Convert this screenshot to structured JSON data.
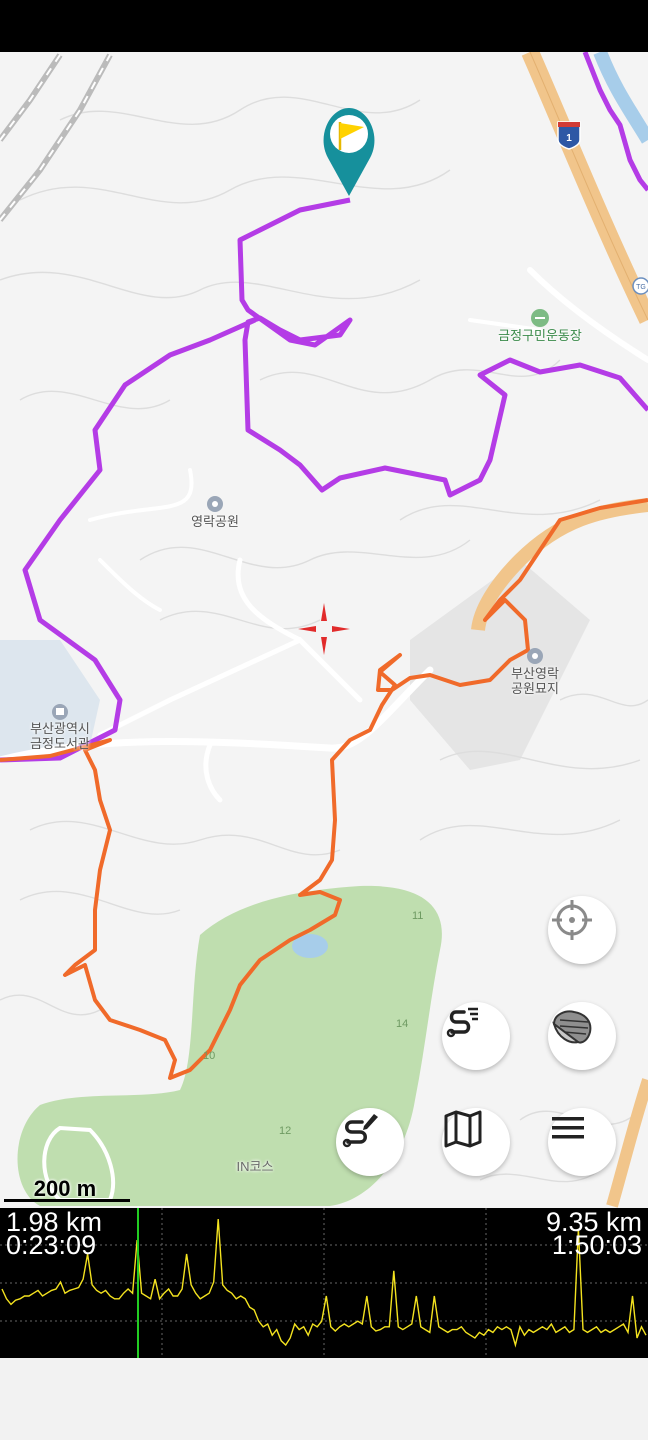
{
  "map": {
    "poi": {
      "sports_ground": "금정구민운동장",
      "park": "영락공원",
      "cemetery": "부산영락\n공원묘지",
      "library": "부산광역시\n금정도서관",
      "highway_shield": "1",
      "toll_gate": "TG",
      "golf_course": "IN코스",
      "holes": [
        "11",
        "14",
        "10",
        "12"
      ]
    },
    "scale_label": "200 m",
    "track_colors": {
      "purple": "#b43ce6",
      "orange": "#f06a2a",
      "highway": "#f1c58b"
    }
  },
  "buttons": {
    "locate": "crosshair-icon",
    "track_list": "track-list-icon",
    "map_style": "layers-icon",
    "draw_route": "route-draw-icon",
    "maps": "map-icon",
    "menu": "menu-icon"
  },
  "elevation": {
    "current_distance": "1.98 km",
    "current_time": "0:23:09",
    "total_distance": "9.35 km",
    "total_time": "1:50:03",
    "line_color": "#f3e21f",
    "cursor_color": "#22cc22",
    "profile_values": [
      0.55,
      0.62,
      0.66,
      0.63,
      0.62,
      0.6,
      0.6,
      0.58,
      0.56,
      0.6,
      0.58,
      0.56,
      0.55,
      0.5,
      0.58,
      0.56,
      0.55,
      0.54,
      0.48,
      0.3,
      0.52,
      0.56,
      0.58,
      0.56,
      0.6,
      0.62,
      0.62,
      0.58,
      0.55,
      0.58,
      0.2,
      0.58,
      0.6,
      0.62,
      0.48,
      0.62,
      0.58,
      0.55,
      0.6,
      0.6,
      0.55,
      0.3,
      0.52,
      0.58,
      0.62,
      0.6,
      0.58,
      0.5,
      0.05,
      0.52,
      0.56,
      0.58,
      0.62,
      0.6,
      0.62,
      0.68,
      0.7,
      0.78,
      0.82,
      0.8,
      0.88,
      0.84,
      0.92,
      0.95,
      0.9,
      0.8,
      0.84,
      0.82,
      0.88,
      0.8,
      0.82,
      0.78,
      0.6,
      0.82,
      0.85,
      0.82,
      0.8,
      0.82,
      0.8,
      0.78,
      0.8,
      0.6,
      0.82,
      0.85,
      0.84,
      0.82,
      0.82,
      0.42,
      0.82,
      0.84,
      0.82,
      0.8,
      0.6,
      0.82,
      0.84,
      0.86,
      0.6,
      0.82,
      0.84,
      0.86,
      0.84,
      0.84,
      0.82,
      0.86,
      0.88,
      0.9,
      0.86,
      0.88,
      0.84,
      0.86,
      0.82,
      0.84,
      0.82,
      0.84,
      0.95,
      0.82,
      0.88,
      0.84,
      0.86,
      0.84,
      0.82,
      0.84,
      0.8,
      0.86,
      0.84,
      0.82,
      0.86,
      0.84,
      0.12,
      0.84,
      0.86,
      0.84,
      0.82,
      0.86,
      0.84,
      0.86,
      0.84,
      0.82,
      0.8,
      0.86,
      0.6,
      0.9,
      0.82,
      0.88
    ]
  }
}
